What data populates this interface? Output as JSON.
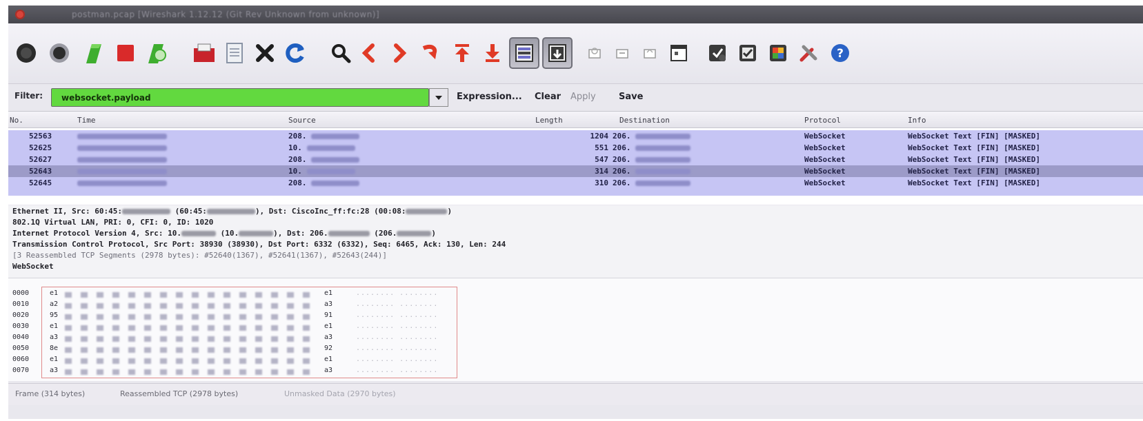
{
  "window": {
    "title": "postman.pcap  [Wireshark 1.12.12 (Git Rev Unknown from unknown)]"
  },
  "toolbar": {
    "icons": [
      "interface-list-icon",
      "capture-options-icon",
      "start-capture-icon",
      "stop-capture-icon",
      "restart-capture-icon",
      "open-file-icon",
      "save-file-icon",
      "close-file-icon",
      "reload-icon",
      "find-packet-icon",
      "go-back-icon",
      "go-forward-icon",
      "go-to-packet-icon",
      "go-to-first-icon",
      "go-to-last-icon",
      "colorize-icon",
      "auto-scroll-icon",
      "zoom-in-icon",
      "zoom-out-icon",
      "normal-size-icon",
      "resize-columns-icon",
      "capture-filters-icon",
      "display-filters-icon",
      "coloring-rules-icon",
      "preferences-icon",
      "help-icon"
    ]
  },
  "filter": {
    "label": "Filter:",
    "value": "websocket.payload",
    "expression_label": "Expression...",
    "clear_label": "Clear",
    "apply_label": "Apply",
    "save_label": "Save"
  },
  "packet_list": {
    "columns": [
      "No.",
      "Time",
      "Source",
      "Length",
      "Destination",
      "Protocol",
      "Info"
    ],
    "rows": [
      {
        "no": "52563",
        "source": "208.",
        "length": "1204",
        "destination": "206.",
        "protocol": "WebSocket",
        "info": "WebSocket Text [FIN] [MASKED]"
      },
      {
        "no": "52625",
        "source": "10.",
        "length": "551",
        "destination": "206.",
        "protocol": "WebSocket",
        "info": "WebSocket Text [FIN] [MASKED]"
      },
      {
        "no": "52627",
        "source": "208.",
        "length": "547",
        "destination": "206.",
        "protocol": "WebSocket",
        "info": "WebSocket Text [FIN] [MASKED]"
      },
      {
        "no": "52643",
        "source": "10.",
        "length": "314",
        "destination": "206.",
        "protocol": "WebSocket",
        "info": "WebSocket Text [FIN] [MASKED]"
      },
      {
        "no": "52645",
        "source": "208.",
        "length": "310",
        "destination": "206.",
        "protocol": "WebSocket",
        "info": "WebSocket Text [FIN] [MASKED]"
      }
    ]
  },
  "details": {
    "lines": [
      {
        "text": "Ethernet II, Src: 60:45:",
        "tail": " (60:45:",
        "tail2": "), Dst: CiscoInc_ff:fc:28 (00:08:",
        "tail3": ")"
      },
      {
        "text": "802.1Q Virtual LAN, PRI: 0, CFI: 0, ID: 1020"
      },
      {
        "text": "Internet Protocol Version 4, Src: 10.",
        "tail": " (10.",
        "tail2": "), Dst: 206.",
        "tail3": " (206.",
        "tail4": ")"
      },
      {
        "text": "Transmission Control Protocol, Src Port: 38930 (38930), Dst Port: 6332 (6332), Seq: 6465, Ack: 130, Len: 244"
      },
      {
        "text": "[3 Reassembled TCP Segments (2978 bytes): #52640(1367), #52641(1367), #52643(244)]"
      },
      {
        "text": "WebSocket"
      }
    ]
  },
  "bytes": {
    "rows": [
      {
        "offset": "0000",
        "first": "e1",
        "last": "e1"
      },
      {
        "offset": "0010",
        "first": "a2",
        "last": "a3"
      },
      {
        "offset": "0020",
        "first": "95",
        "last": "91"
      },
      {
        "offset": "0030",
        "first": "e1",
        "last": "e1"
      },
      {
        "offset": "0040",
        "first": "a3",
        "last": "a3"
      },
      {
        "offset": "0050",
        "first": "8e",
        "last": "92"
      },
      {
        "offset": "0060",
        "first": "e1",
        "last": "e1"
      },
      {
        "offset": "0070",
        "first": "a3",
        "last": "a3"
      }
    ],
    "dots": "........ ........"
  },
  "tabs": [
    {
      "label": "Frame (314 bytes)"
    },
    {
      "label": "Reassembled TCP (2978 bytes)"
    },
    {
      "label": "Unmasked Data (2970 bytes)"
    }
  ],
  "colors": {
    "filter_valid": "#62d93f",
    "row_highlight": "#c6c5f4",
    "selected_row": "#9c9bc8",
    "hex_border": "#e08a8a"
  }
}
